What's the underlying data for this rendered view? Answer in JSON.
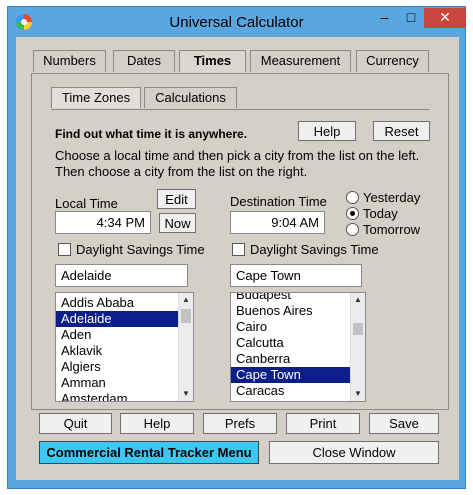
{
  "window": {
    "title": "Universal Calculator",
    "min_label": "–",
    "max_label": "□",
    "close_label": "✕"
  },
  "tabs": [
    {
      "label": "Numbers"
    },
    {
      "label": "Dates"
    },
    {
      "label": "Times"
    },
    {
      "label": "Measurement"
    },
    {
      "label": "Currency"
    }
  ],
  "subtabs": [
    {
      "label": "Time Zones"
    },
    {
      "label": "Calculations"
    }
  ],
  "intro": {
    "headline": "Find out what time it is anywhere.",
    "line1": "Choose a local time and then pick a city from the list on the left.",
    "line2": "Then choose a city from the list on the right."
  },
  "buttons": {
    "help": "Help",
    "reset": "Reset",
    "edit": "Edit",
    "now": "Now"
  },
  "local": {
    "label": "Local Time",
    "time": "4:34 PM",
    "dst_label": "Daylight Savings Time",
    "dst_checked": false,
    "city": "Adelaide",
    "list": [
      "Addis Ababa",
      "Adelaide",
      "Aden",
      "Aklavik",
      "Algiers",
      "Amman",
      "Amsterdam"
    ],
    "selected_index": 1
  },
  "destination": {
    "label": "Destination Time",
    "time": "9:04 AM",
    "dst_label": "Daylight Savings Time",
    "dst_checked": false,
    "city": "Cape Town",
    "list": [
      "Budapest",
      "Buenos Aires",
      "Cairo",
      "Calcutta",
      "Canberra",
      "Cape Town",
      "Caracas"
    ],
    "selected_index": 5
  },
  "day_options": [
    {
      "label": "Yesterday",
      "checked": false
    },
    {
      "label": "Today",
      "checked": true
    },
    {
      "label": "Tomorrow",
      "checked": false
    }
  ],
  "bottom": {
    "quit": "Quit",
    "help": "Help",
    "prefs": "Prefs",
    "print": "Print",
    "save": "Save",
    "rental_menu": "Commercial Rental Tracker Menu",
    "close_window": "Close Window"
  },
  "colors": {
    "title_bar": "#5aa6e1",
    "selection": "#0a1f8a",
    "accent_button": "#3cc8f5",
    "close_button": "#c8463b"
  },
  "icons": [
    "app-icon",
    "minimize-icon",
    "maximize-icon",
    "close-icon",
    "scroll-up-icon",
    "scroll-down-icon"
  ]
}
